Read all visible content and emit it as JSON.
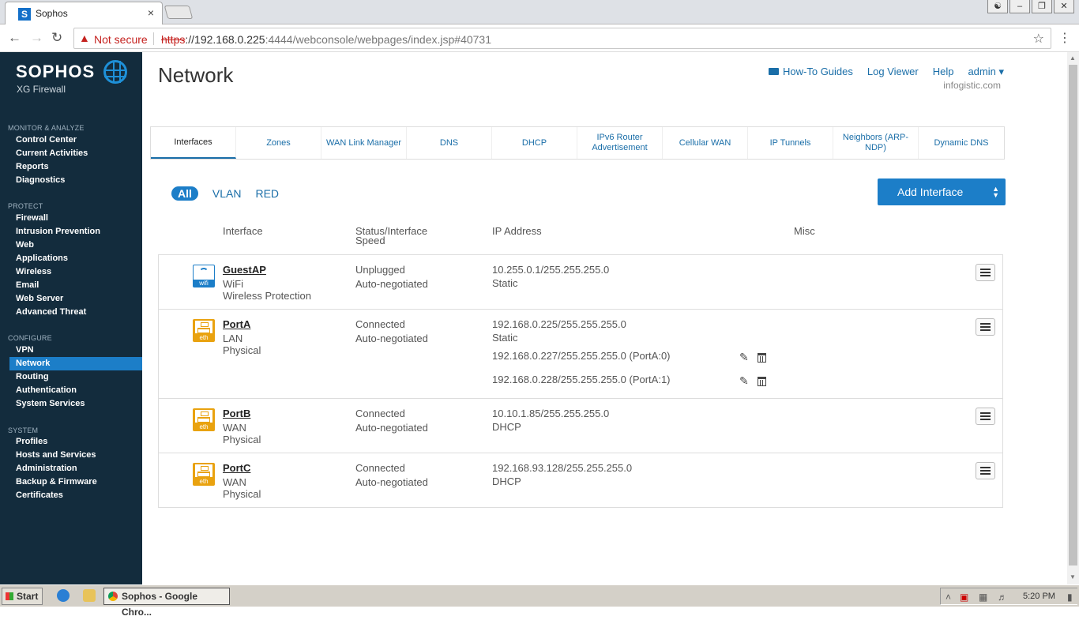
{
  "browser": {
    "tab_title": "Sophos",
    "tab_close": "×",
    "not_secure": "Not secure",
    "url_scheme": "https",
    "url_host": "://192.168.0.225",
    "url_rest": ":4444/webconsole/webpages/index.jsp#40731"
  },
  "sidebar": {
    "brand": "SOPHOS",
    "product": "XG Firewall",
    "sections": {
      "monitor": "MONITOR & ANALYZE",
      "protect": "PROTECT",
      "configure": "CONFIGURE",
      "system": "SYSTEM"
    },
    "monitor_items": [
      "Control Center",
      "Current Activities",
      "Reports",
      "Diagnostics"
    ],
    "protect_items": [
      "Firewall",
      "Intrusion Prevention",
      "Web",
      "Applications",
      "Wireless",
      "Email",
      "Web Server",
      "Advanced Threat"
    ],
    "configure_items": [
      "VPN",
      "Network",
      "Routing",
      "Authentication",
      "System Services"
    ],
    "system_items": [
      "Profiles",
      "Hosts and Services",
      "Administration",
      "Backup & Firmware",
      "Certificates"
    ],
    "active_item": "Network"
  },
  "header": {
    "title": "Network",
    "links": {
      "howto": "How-To Guides",
      "logviewer": "Log Viewer",
      "help": "Help",
      "admin": "admin ▾"
    },
    "domain": "infogistic.com"
  },
  "tabs": [
    "Interfaces",
    "Zones",
    "WAN Link Manager",
    "DNS",
    "DHCP",
    "IPv6 Router Advertisement",
    "Cellular WAN",
    "IP Tunnels",
    "Neighbors (ARP-NDP)",
    "Dynamic DNS"
  ],
  "selected_tab": "Interfaces",
  "filters": [
    "All",
    "VLAN",
    "RED"
  ],
  "selected_filter": "All",
  "add_button": "Add Interface",
  "columns": {
    "interface": "Interface",
    "status": "Status/Interface Speed",
    "ip": "IP Address",
    "misc": "Misc"
  },
  "interfaces": [
    {
      "name": "GuestAP",
      "icon": "wifi-icon",
      "badge": "wifi",
      "zone": "WiFi",
      "type": "Wireless Protection",
      "status": "Unplugged",
      "speed": "Auto-negotiated",
      "ip": "10.255.0.1/255.255.255.0",
      "mode": "Static",
      "aliases": []
    },
    {
      "name": "PortA",
      "icon": "ethernet-icon",
      "badge": "eth",
      "zone": "LAN",
      "type": "Physical",
      "status": "Connected",
      "speed": "Auto-negotiated",
      "ip": "192.168.0.225/255.255.255.0",
      "mode": "Static",
      "aliases": [
        "192.168.0.227/255.255.255.0 (PortA:0)",
        "192.168.0.228/255.255.255.0 (PortA:1)"
      ]
    },
    {
      "name": "PortB",
      "icon": "ethernet-icon",
      "badge": "eth",
      "zone": "WAN",
      "type": "Physical",
      "status": "Connected",
      "speed": "Auto-negotiated",
      "ip": "10.10.1.85/255.255.255.0",
      "mode": "DHCP",
      "aliases": []
    },
    {
      "name": "PortC",
      "icon": "ethernet-icon",
      "badge": "eth",
      "zone": "WAN",
      "type": "Physical",
      "status": "Connected",
      "speed": "Auto-negotiated",
      "ip": "192.168.93.128/255.255.255.0",
      "mode": "DHCP",
      "aliases": []
    }
  ],
  "taskbar": {
    "start": "Start",
    "task": "Sophos - Google Chro...",
    "time": "5:20 PM"
  },
  "colors": {
    "sidebar_bg": "#132c3d",
    "accent": "#1c7ec8",
    "eth_icon": "#e9a20f",
    "link": "#1a6ea8"
  }
}
